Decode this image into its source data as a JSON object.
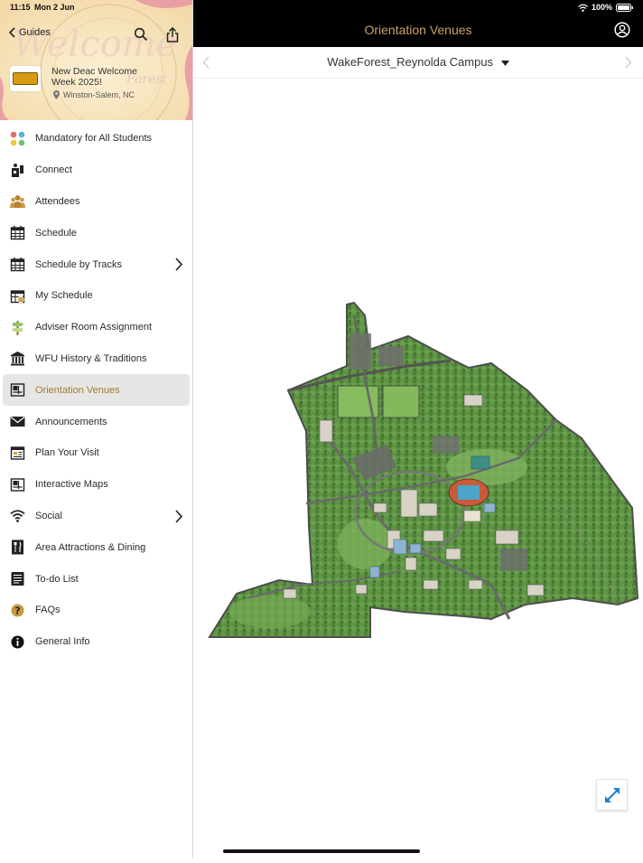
{
  "status": {
    "time": "11:15",
    "date": "Mon 2 Jun",
    "battery": "100%"
  },
  "guide": {
    "back_label": "Guides",
    "event_title": "New Deac Welcome Week 2025!",
    "location": "Winston-Salem, NC",
    "banner_text": "Welcome",
    "banner_subtext": "Forest"
  },
  "menu": [
    {
      "label": "Mandatory for All Students",
      "icon": "dots-icon"
    },
    {
      "label": "Connect",
      "icon": "connect-icon"
    },
    {
      "label": "Attendees",
      "icon": "people-icon"
    },
    {
      "label": "Schedule",
      "icon": "calendar-icon"
    },
    {
      "label": "Schedule by Tracks",
      "icon": "calendar-icon",
      "has_children": true
    },
    {
      "label": "My Schedule",
      "icon": "my-calendar-icon"
    },
    {
      "label": "Adviser Room Assignment",
      "icon": "signpost-icon"
    },
    {
      "label": "WFU History & Traditions",
      "icon": "building-icon"
    },
    {
      "label": "Orientation Venues",
      "icon": "map-icon",
      "selected": true
    },
    {
      "label": "Announcements",
      "icon": "envelope-icon"
    },
    {
      "label": "Plan Your Visit",
      "icon": "browser-icon"
    },
    {
      "label": "Interactive Maps",
      "icon": "map-icon"
    },
    {
      "label": "Social",
      "icon": "wifi-icon",
      "has_children": true
    },
    {
      "label": "Area Attractions & Dining",
      "icon": "dining-icon"
    },
    {
      "label": "To-do List",
      "icon": "list-icon"
    },
    {
      "label": "FAQs",
      "icon": "question-icon"
    },
    {
      "label": "General Info",
      "icon": "info-icon"
    }
  ],
  "main": {
    "title": "Orientation Venues",
    "campus_selector": "WakeForest_Reynolda Campus"
  },
  "colors": {
    "accent": "#c9a266",
    "selected_text": "#a67c2c",
    "topbar": "#000000",
    "map_green": "#5e9444",
    "expand_icon": "#1a7fd1"
  }
}
